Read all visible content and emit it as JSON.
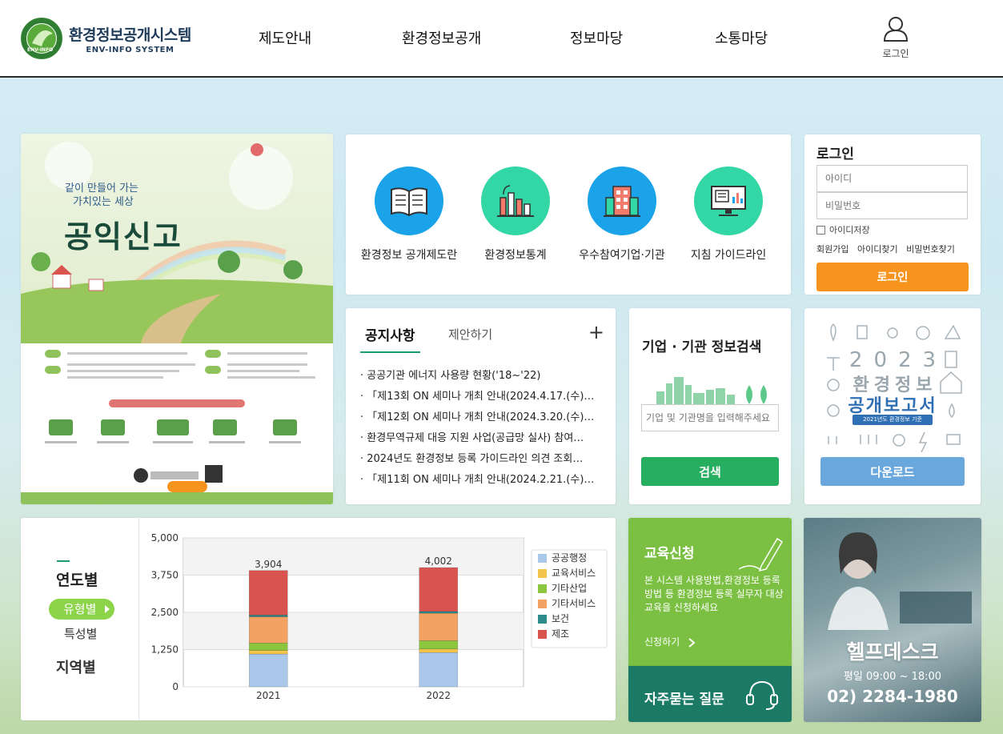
{
  "header": {
    "logo_title": "환경정보공개시스템",
    "logo_sub": "ENV-INFO SYSTEM",
    "logo_ring_text": "ENV-INFO",
    "nav": [
      "제도안내",
      "환경정보공개",
      "정보마당",
      "소통마당"
    ],
    "login_label": "로그인"
  },
  "banner": {
    "top_text_1": "같이 만들어 가는",
    "top_text_2": "가치있는 세상",
    "title": "공익신고"
  },
  "shortcuts": [
    {
      "label": "환경정보 공개제도란",
      "icon": "book-icon",
      "color": "#1aa3e8"
    },
    {
      "label": "환경정보통계",
      "icon": "bar-chart-icon",
      "color": "#33d6a5"
    },
    {
      "label": "우수참여기업·기관",
      "icon": "building-icon",
      "color": "#1aa3e8"
    },
    {
      "label": "지침 가이드라인",
      "icon": "monitor-icon",
      "color": "#33d6a5"
    }
  ],
  "login": {
    "title": "로그인",
    "id_placeholder": "아이디",
    "pw_placeholder": "비밀번호",
    "save_id": "아이디저장",
    "links": [
      "회원가입",
      "아이디찾기",
      "비밀번호찾기"
    ],
    "button": "로그인"
  },
  "notice": {
    "tab_active": "공지사항",
    "tab_inactive": "제안하기",
    "more": "+",
    "items": [
      "· 공공기관 에너지 사용량 현황('18~'22)",
      "· 「제13회 ON 세미나 개최 안내(2024.4.17.(수)…",
      "· 「제12회 ON 세미나 개최 안내(2024.3.20.(수)…",
      "· 환경무역규제 대응 지원 사업(공급망 실사) 참여…",
      "· 2024년도 환경정보 등록 가이드라인 의견 조회…",
      "· 「제11회 ON 세미나 개최 안내(2024.2.21.(수)…"
    ]
  },
  "company_search": {
    "title": "기업 · 기관 정보검색",
    "placeholder": "기업 및 기관명을 입력해주세요",
    "button": "검색"
  },
  "report": {
    "year": "2023",
    "title_1": "환경정보",
    "title_2": "공개보고서",
    "tag": "2021년도 환경정보 기준",
    "button": "다운로드"
  },
  "stats_menu": {
    "m1": "연도별",
    "m2": "유형별",
    "m3": "특성별",
    "m4": "지역별"
  },
  "chart_data": {
    "type": "bar",
    "stacked": true,
    "categories": [
      "2021",
      "2022"
    ],
    "totals": [
      3904,
      4002
    ],
    "ylim": [
      0,
      5000
    ],
    "yticks": [
      "5,000",
      "3,750",
      "2,500",
      "1,250",
      "0"
    ],
    "series": [
      {
        "name": "공공행정",
        "color": "#aac9ea",
        "values": [
          1100,
          1150
        ]
      },
      {
        "name": "교육서비스",
        "color": "#f5c44a",
        "values": [
          120,
          120
        ]
      },
      {
        "name": "기타산업",
        "color": "#8cc63f",
        "values": [
          250,
          280
        ]
      },
      {
        "name": "기타서비스",
        "color": "#f4a261",
        "values": [
          880,
          920
        ]
      },
      {
        "name": "보건",
        "color": "#2c8c8c",
        "values": [
          60,
          60
        ]
      },
      {
        "name": "제조",
        "color": "#d9534f",
        "values": [
          1494,
          1472
        ]
      }
    ],
    "legend_position": "right",
    "grid": true
  },
  "edu": {
    "title": "교육신청",
    "desc": "본 시스템 사용방법,환경정보 등록방법 등 환경정보 등록 실무자 대상 교육을 신청하세요",
    "apply": "신청하기"
  },
  "faq": {
    "label": "자주묻는 질문"
  },
  "help": {
    "title": "헬프데스크",
    "hours": "평일 09:00 ~ 18:00",
    "phone": "02) 2284-1980"
  }
}
